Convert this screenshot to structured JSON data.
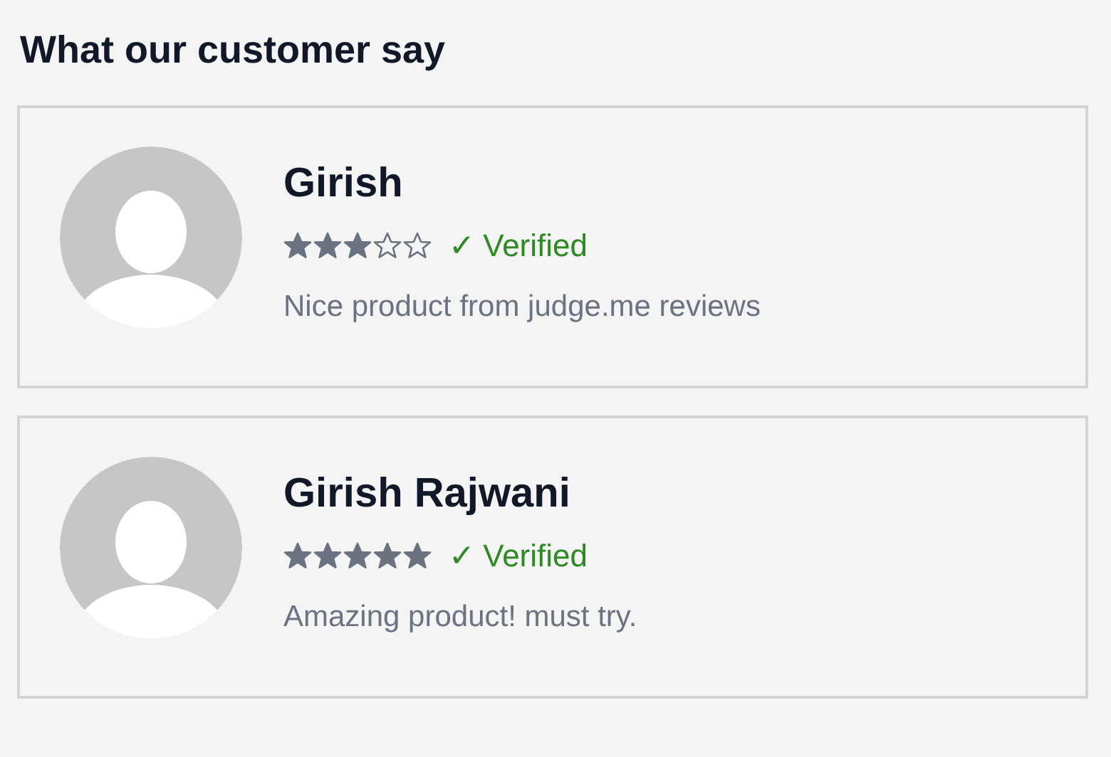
{
  "title": "What our customer say",
  "reviews": [
    {
      "name": "Girish",
      "stars": 3,
      "badge": "✓ Verified",
      "text": "Nice product from judge.me reviews"
    },
    {
      "name": "Girish Rajwani",
      "stars": 5,
      "badge": "✓ Verified",
      "text": "Amazing product! must try."
    }
  ]
}
